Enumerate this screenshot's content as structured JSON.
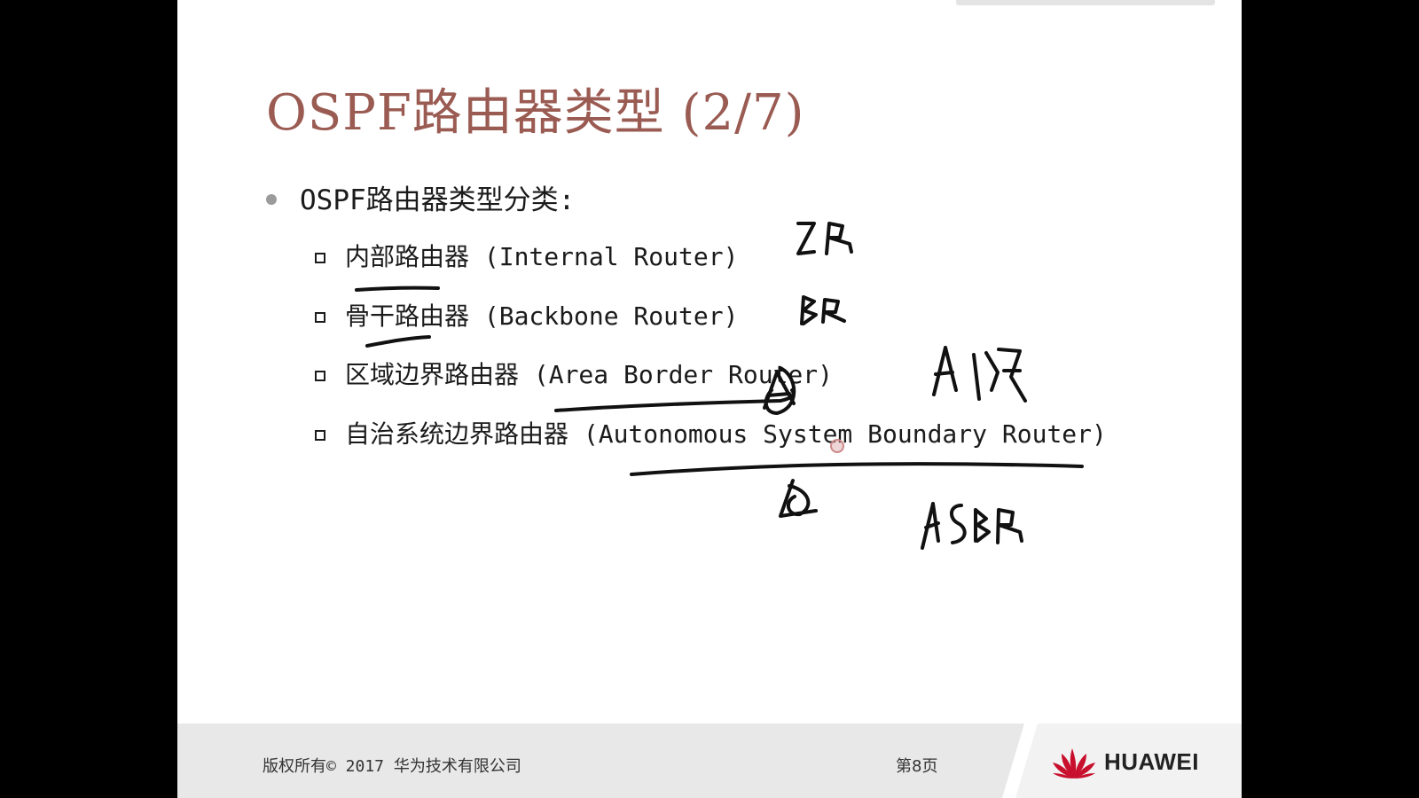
{
  "slide": {
    "title": "OSPF路由器类型 (2/7)",
    "main_bullet": "OSPF路由器类型分类:",
    "sub_bullets": [
      "内部路由器 (Internal Router)",
      "骨干路由器 (Backbone Router)",
      "区域边界路由器 (Area Border Router)",
      "自治系统边界路由器 (Autonomous System Boundary Router)"
    ]
  },
  "footer": {
    "copyright": "版权所有© 2017 华为技术有限公司",
    "page_number": "第8页",
    "brand": "HUAWEI"
  },
  "annotations": {
    "handwriting": [
      "IR",
      "BR",
      "A",
      "ASBR"
    ]
  },
  "colors": {
    "title": "#9a5b52",
    "footer_bg": "#e8e8e8",
    "logo_red": "#c8102e"
  }
}
